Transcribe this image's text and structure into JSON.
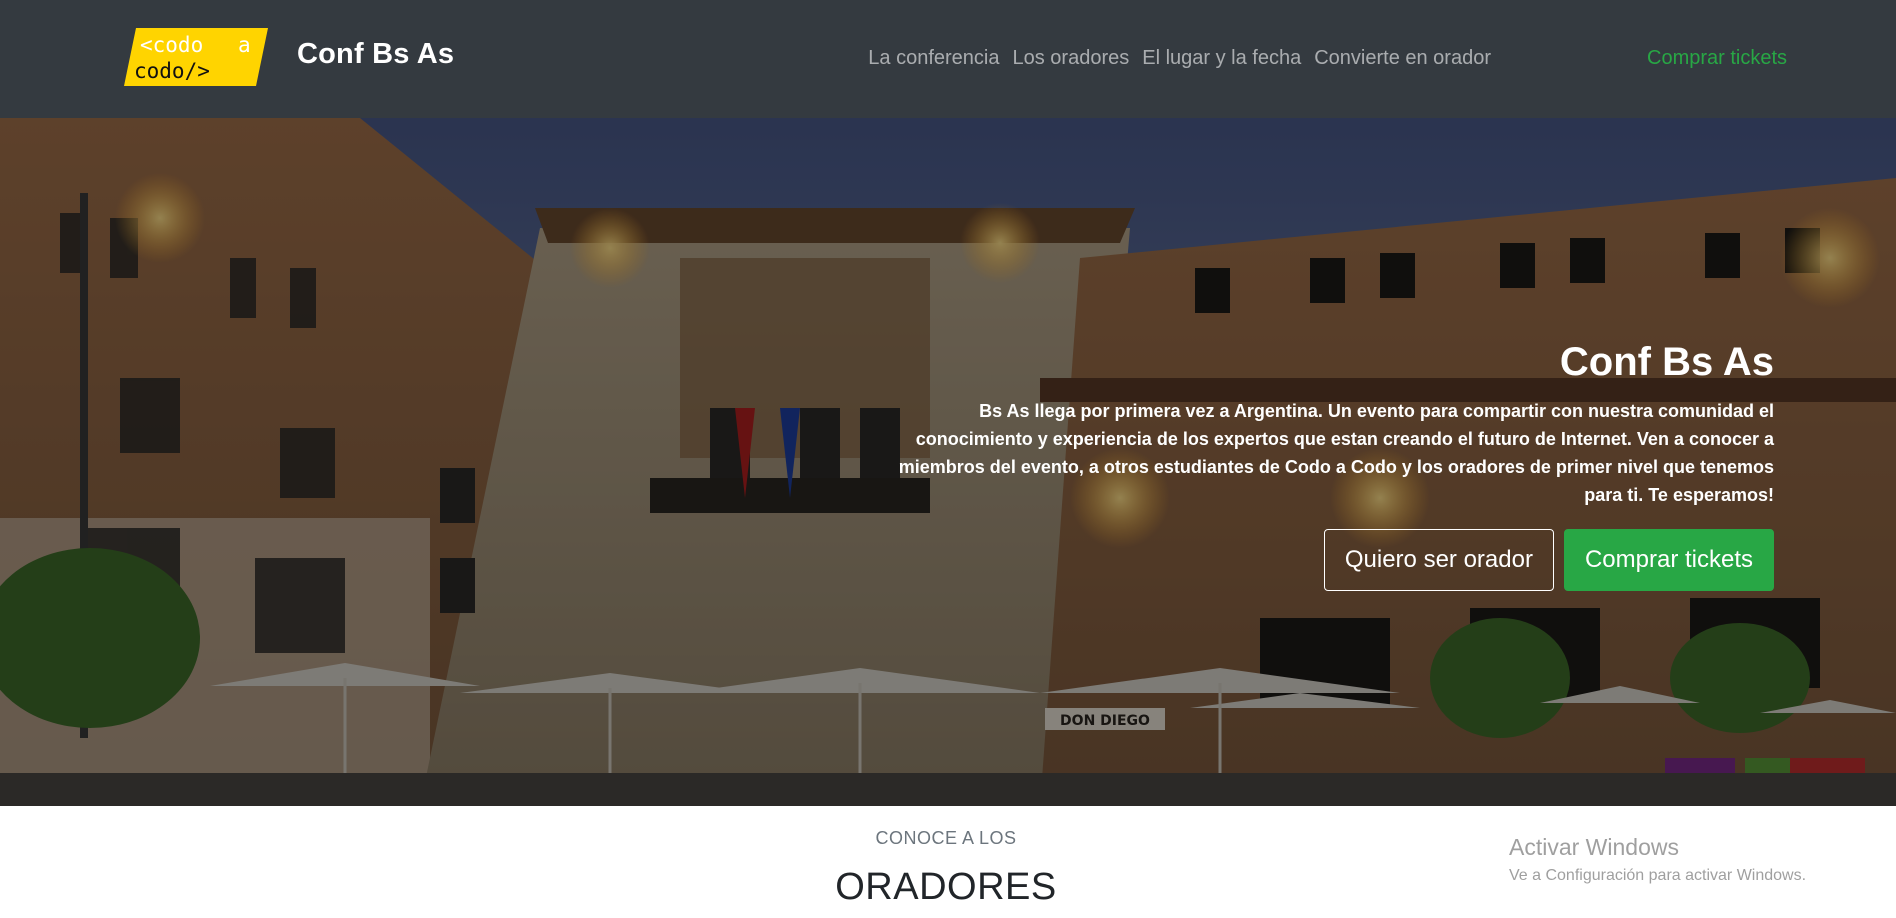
{
  "brand": {
    "logo_line1_a": "<codo",
    "logo_line1_b": "a",
    "logo_line2": "codo/>",
    "title": "Conf Bs As"
  },
  "nav": {
    "items": [
      "La conferencia",
      "Los oradores",
      "El lugar y la fecha",
      "Convierte en orador"
    ],
    "cta": "Comprar tickets"
  },
  "hero": {
    "title": "Conf Bs As",
    "text": "Bs As llega por primera vez a Argentina. Un evento para compartir con nuestra comunidad el conocimiento y experiencia de los expertos que estan creando el futuro de Internet. Ven a conocer a miembros del evento, a otros estudiantes de Codo a Codo y los oradores de primer nivel que tenemos para ti. Te esperamos!",
    "btn_outline": "Quiero ser orador",
    "btn_primary": "Comprar tickets",
    "storefront_sign": "DON DIEGO"
  },
  "section": {
    "subtitle": "CONOCE A LOS",
    "title": "ORADORES"
  },
  "watermark": {
    "title": "Activar Windows",
    "subtitle": "Ve a Configuración para activar Windows."
  },
  "colors": {
    "navbar": "#343a40",
    "accent": "#28a745",
    "logo_yellow": "#ffd400"
  }
}
